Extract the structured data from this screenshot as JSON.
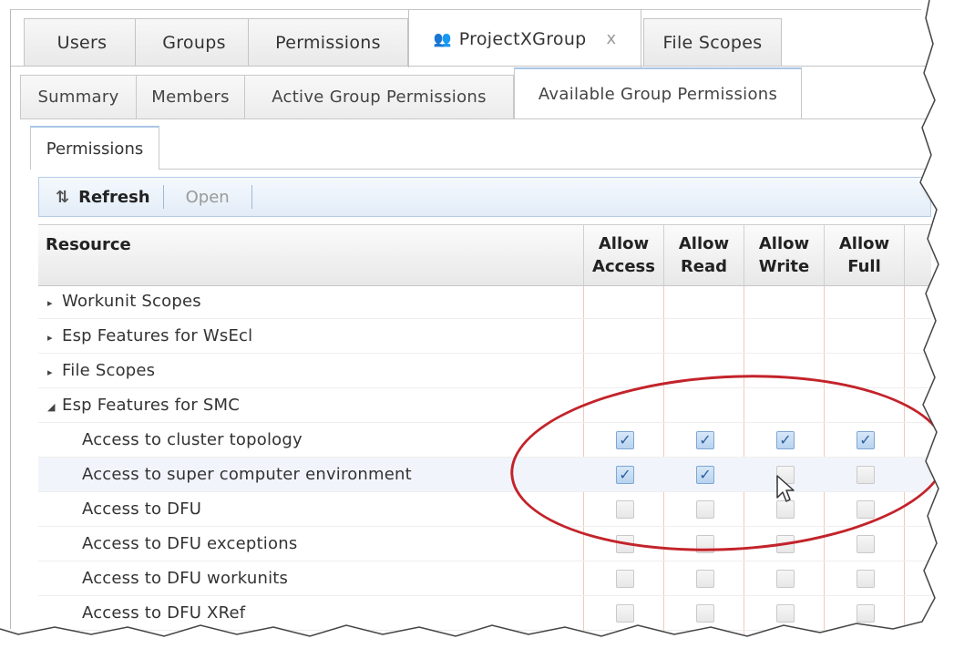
{
  "tabs_level1": [
    {
      "label": "Users"
    },
    {
      "label": "Groups"
    },
    {
      "label": "Permissions"
    },
    {
      "label": "ProjectXGroup",
      "active": true,
      "icon": "group-icon",
      "closable": true
    },
    {
      "label": "File Scopes"
    }
  ],
  "tab_close_glyph": "x",
  "tabs_level2": [
    {
      "label": "Summary"
    },
    {
      "label": "Members"
    },
    {
      "label": "Active Group Permissions"
    },
    {
      "label": "Available Group Permissions",
      "active": true
    }
  ],
  "tab_level3": {
    "label": "Permissions"
  },
  "toolbar": {
    "refresh_label": "Refresh",
    "refresh_icon": "refresh-icon",
    "open_label": "Open"
  },
  "grid": {
    "columns": [
      {
        "line1": "Resource",
        "line2": ""
      },
      {
        "line1": "Allow",
        "line2": "Access"
      },
      {
        "line1": "Allow",
        "line2": "Read"
      },
      {
        "line1": "Allow",
        "line2": "Write"
      },
      {
        "line1": "Allow",
        "line2": "Full"
      }
    ],
    "rows": [
      {
        "label": "Workunit Scopes",
        "type": "group",
        "expanded": false
      },
      {
        "label": "Esp Features for WsEcl",
        "type": "group",
        "expanded": false
      },
      {
        "label": "File Scopes",
        "type": "group",
        "expanded": false
      },
      {
        "label": "Esp Features for SMC",
        "type": "group",
        "expanded": true
      },
      {
        "label": "Access to cluster topology",
        "type": "child",
        "access": true,
        "read": true,
        "write": true,
        "full": true
      },
      {
        "label": "Access to super computer environment",
        "type": "child",
        "access": true,
        "read": true,
        "write": false,
        "full": false,
        "highlight": true
      },
      {
        "label": "Access to DFU",
        "type": "child",
        "access": false,
        "read": false,
        "write": false,
        "full": false
      },
      {
        "label": "Access to DFU exceptions",
        "type": "child",
        "access": false,
        "read": false,
        "write": false,
        "full": false
      },
      {
        "label": "Access to DFU workunits",
        "type": "child",
        "access": false,
        "read": false,
        "write": false,
        "full": false
      },
      {
        "label": "Access to DFU XRef",
        "type": "child",
        "access": false,
        "read": false,
        "write": false,
        "full": false
      }
    ]
  },
  "colors": {
    "annotation": "#c3232a",
    "toolbar_bg": "#e2ecf7",
    "checkbox_checked": "#b8d3ef"
  }
}
